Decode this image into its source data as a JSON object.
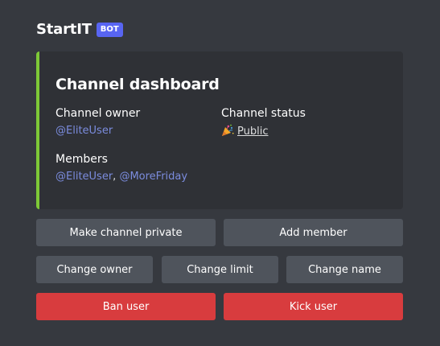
{
  "header": {
    "app_name": "StartIT",
    "badge": "BOT"
  },
  "embed": {
    "accent_color": "#7dc837",
    "title": "Channel dashboard",
    "fields": {
      "owner": {
        "name": "Channel owner",
        "value": "@EliteUser"
      },
      "status": {
        "name": "Channel status",
        "icon": "party-popper-icon",
        "value": "Public"
      },
      "members": {
        "name": "Members",
        "values": [
          "@EliteUser",
          "@MoreFriday"
        ],
        "separator": ", "
      }
    }
  },
  "buttons": {
    "make_private": "Make channel private",
    "add_member": "Add member",
    "change_owner": "Change owner",
    "change_limit": "Change limit",
    "change_name": "Change name",
    "ban_user": "Ban user",
    "kick_user": "Kick user"
  },
  "colors": {
    "background": "#36393f",
    "embed_background": "#2f3136",
    "secondary_button": "#4f545c",
    "danger_button": "#d83c3e",
    "mention": "#7b8cde",
    "bot_badge": "#5865f2"
  }
}
